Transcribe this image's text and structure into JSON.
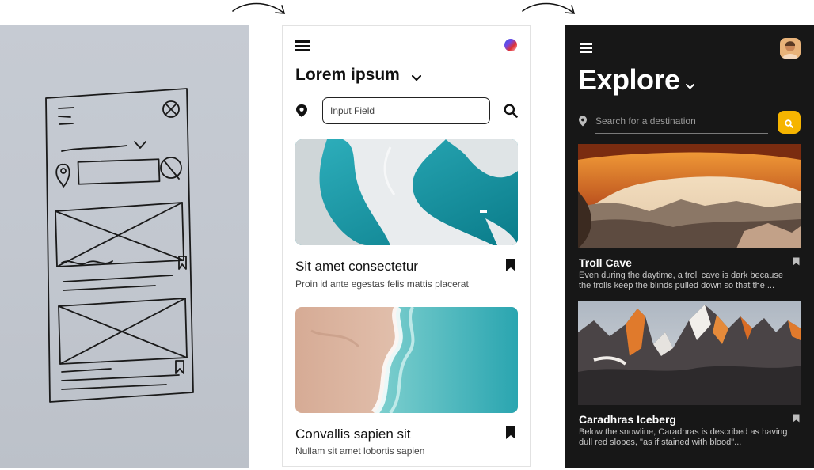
{
  "wireframe": {
    "title": "Lorem ipsum",
    "search": {
      "placeholder": "Input Field"
    },
    "cards": [
      {
        "title": "Sit amet consectetur",
        "subtitle": "Proin id ante egestas felis mattis placerat"
      },
      {
        "title": "Convallis sapien sit",
        "subtitle": "Nullam sit amet lobortis sapien"
      }
    ]
  },
  "mockup": {
    "title": "Explore",
    "search": {
      "placeholder": "Search for a destination"
    },
    "accent": "#f6b400",
    "background": "#171717",
    "cards": [
      {
        "title": "Troll Cave",
        "description": "Even during the daytime, a troll cave is dark because the trolls keep the blinds pulled down so that the ..."
      },
      {
        "title": "Caradhras Iceberg",
        "description": "Below the snowline, Caradhras is described as having dull red slopes, \"as if stained with blood\"..."
      }
    ]
  },
  "icons": {
    "menu": "hamburger-icon",
    "location": "map-pin-icon",
    "search": "search-icon",
    "bookmark": "bookmark-icon",
    "dropdown": "chevron-down-icon"
  }
}
